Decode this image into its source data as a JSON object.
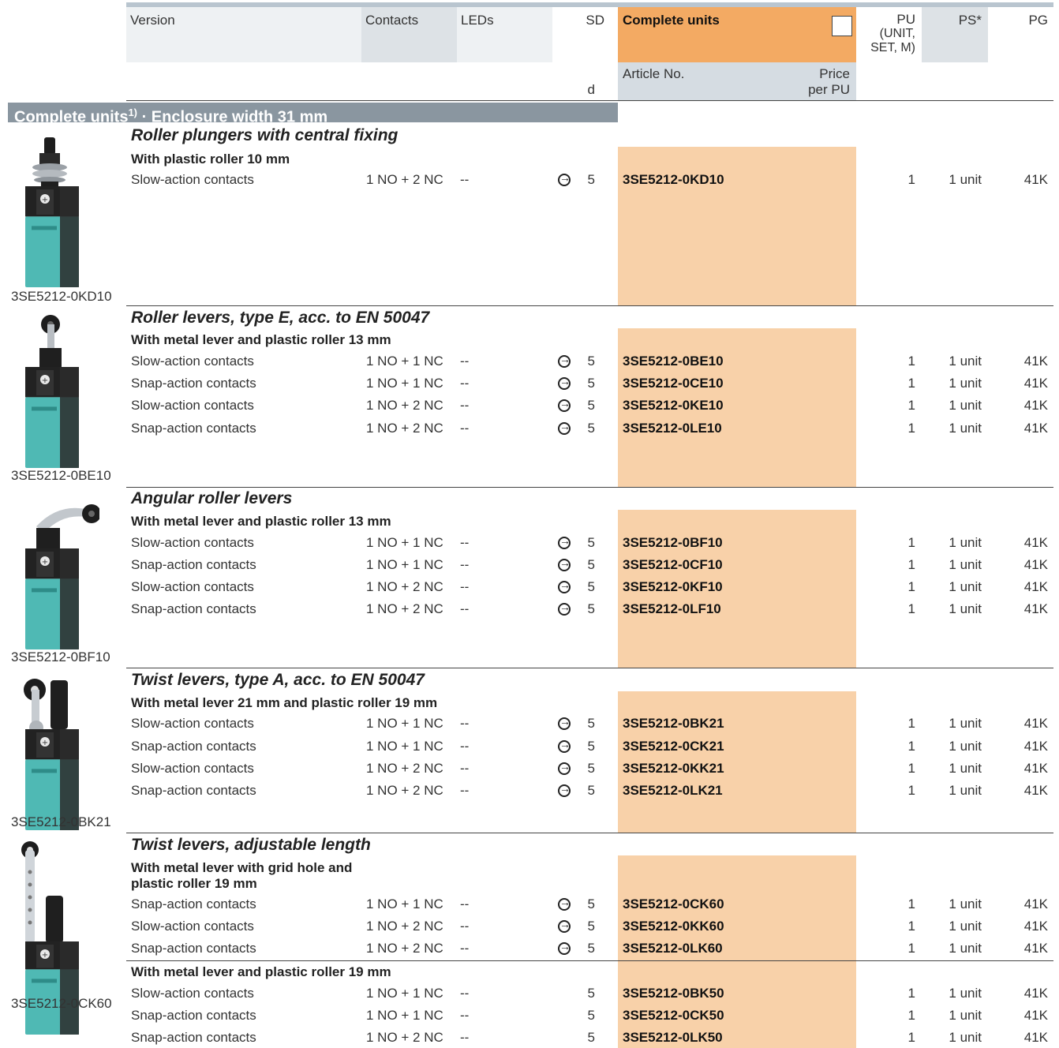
{
  "header": {
    "version": "Version",
    "contacts": "Contacts",
    "leds": "LEDs",
    "sd": "SD",
    "sd_unit": "d",
    "complete_units": "Complete units",
    "article_no": "Article No.",
    "price_line1": "Price",
    "price_line2": "per PU",
    "pu_line1": "PU",
    "pu_line2": "(UNIT,",
    "pu_line3": "SET, M)",
    "ps": "PS*",
    "pg": "PG"
  },
  "section": {
    "title": "Complete units",
    "footnote": "1)",
    "suffix": " · Enclosure width 31 mm"
  },
  "groups": [
    {
      "title": "Roller plungers with central fixing",
      "caption": "3SE5212-0KD10",
      "subgroups": [
        {
          "subtitle": "With plastic roller 10 mm",
          "rows": [
            {
              "version": "Slow-action contacts",
              "contacts": "1 NO + 2 NC",
              "leds": "--",
              "sd": "5",
              "article": "3SE5212-0KD10",
              "pu": "1",
              "ps": "1 unit",
              "pg": "41K"
            }
          ]
        }
      ]
    },
    {
      "title": "Roller levers, type E, acc. to EN 50047",
      "caption": "3SE5212-0BE10",
      "subgroups": [
        {
          "subtitle": "With metal lever and plastic roller 13 mm",
          "rows": [
            {
              "version": "Slow-action contacts",
              "contacts": "1 NO + 1 NC",
              "leds": "--",
              "sd": "5",
              "article": "3SE5212-0BE10",
              "pu": "1",
              "ps": "1 unit",
              "pg": "41K"
            },
            {
              "version": "Snap-action contacts",
              "contacts": "1 NO + 1 NC",
              "leds": "--",
              "sd": "5",
              "article": "3SE5212-0CE10",
              "pu": "1",
              "ps": "1 unit",
              "pg": "41K"
            },
            {
              "version": "Slow-action contacts",
              "contacts": "1 NO + 2 NC",
              "leds": "--",
              "sd": "5",
              "article": "3SE5212-0KE10",
              "pu": "1",
              "ps": "1 unit",
              "pg": "41K"
            },
            {
              "version": "Snap-action contacts",
              "contacts": "1 NO + 2 NC",
              "leds": "--",
              "sd": "5",
              "article": "3SE5212-0LE10",
              "pu": "1",
              "ps": "1 unit",
              "pg": "41K"
            }
          ]
        }
      ]
    },
    {
      "title": "Angular roller levers",
      "caption": "3SE5212-0BF10",
      "subgroups": [
        {
          "subtitle": "With metal lever and plastic roller 13 mm",
          "rows": [
            {
              "version": "Slow-action contacts",
              "contacts": "1 NO + 1 NC",
              "leds": "--",
              "sd": "5",
              "article": "3SE5212-0BF10",
              "pu": "1",
              "ps": "1 unit",
              "pg": "41K"
            },
            {
              "version": "Snap-action contacts",
              "contacts": "1 NO + 1 NC",
              "leds": "--",
              "sd": "5",
              "article": "3SE5212-0CF10",
              "pu": "1",
              "ps": "1 unit",
              "pg": "41K"
            },
            {
              "version": "Slow-action contacts",
              "contacts": "1 NO + 2 NC",
              "leds": "--",
              "sd": "5",
              "article": "3SE5212-0KF10",
              "pu": "1",
              "ps": "1 unit",
              "pg": "41K"
            },
            {
              "version": "Snap-action contacts",
              "contacts": "1 NO + 2 NC",
              "leds": "--",
              "sd": "5",
              "article": "3SE5212-0LF10",
              "pu": "1",
              "ps": "1 unit",
              "pg": "41K"
            }
          ]
        }
      ]
    },
    {
      "title": "Twist levers, type A, acc. to EN 50047",
      "caption": "3SE5212-0BK21",
      "subgroups": [
        {
          "subtitle": "With metal lever 21 mm and plastic roller 19 mm",
          "rows": [
            {
              "version": "Slow-action contacts",
              "contacts": "1 NO + 1 NC",
              "leds": "--",
              "sd": "5",
              "article": "3SE5212-0BK21",
              "pu": "1",
              "ps": "1 unit",
              "pg": "41K"
            },
            {
              "version": "Snap-action contacts",
              "contacts": "1 NO + 1 NC",
              "leds": "--",
              "sd": "5",
              "article": "3SE5212-0CK21",
              "pu": "1",
              "ps": "1 unit",
              "pg": "41K"
            },
            {
              "version": "Slow-action contacts",
              "contacts": "1 NO + 2 NC",
              "leds": "--",
              "sd": "5",
              "article": "3SE5212-0KK21",
              "pu": "1",
              "ps": "1 unit",
              "pg": "41K"
            },
            {
              "version": "Snap-action contacts",
              "contacts": "1 NO + 2 NC",
              "leds": "--",
              "sd": "5",
              "article": "3SE5212-0LK21",
              "pu": "1",
              "ps": "1 unit",
              "pg": "41K"
            }
          ]
        }
      ]
    },
    {
      "title": "Twist levers, adjustable length",
      "caption": "3SE5212-0CK60",
      "subgroups": [
        {
          "subtitle": "With metal lever with grid hole and",
          "subtitle2": "plastic roller 19 mm",
          "rows": [
            {
              "version": "Snap-action contacts",
              "contacts": "1 NO + 1 NC",
              "leds": "--",
              "sd": "5",
              "article": "3SE5212-0CK60",
              "pu": "1",
              "ps": "1 unit",
              "pg": "41K"
            },
            {
              "version": "Slow-action contacts",
              "contacts": "1 NO + 2 NC",
              "leds": "--",
              "sd": "5",
              "article": "3SE5212-0KK60",
              "pu": "1",
              "ps": "1 unit",
              "pg": "41K"
            },
            {
              "version": "Snap-action contacts",
              "contacts": "1 NO + 2 NC",
              "leds": "--",
              "sd": "5",
              "article": "3SE5212-0LK60",
              "pu": "1",
              "ps": "1 unit",
              "pg": "41K"
            }
          ]
        },
        {
          "subtitle": "With metal lever and plastic roller 19 mm",
          "rows": [
            {
              "version": "Slow-action contacts",
              "contacts": "1 NO + 1 NC",
              "leds": "--",
              "sd": "5",
              "article": "3SE5212-0BK50",
              "pu": "1",
              "ps": "1 unit",
              "pg": "41K"
            },
            {
              "version": "Snap-action contacts",
              "contacts": "1 NO + 1 NC",
              "leds": "--",
              "sd": "5",
              "article": "3SE5212-0CK50",
              "pu": "1",
              "ps": "1 unit",
              "pg": "41K"
            },
            {
              "version": "Snap-action contacts",
              "contacts": "1 NO + 2 NC",
              "leds": "--",
              "sd": "5",
              "article": "3SE5212-0LK50",
              "pu": "1",
              "ps": "1 unit",
              "pg": "41K"
            }
          ]
        }
      ]
    }
  ],
  "colors": {
    "header_orange": "#f3aa63",
    "column_peach": "#f8d1a9",
    "section_bar": "#8a96a0",
    "product_teal": "#4fb9b4"
  }
}
